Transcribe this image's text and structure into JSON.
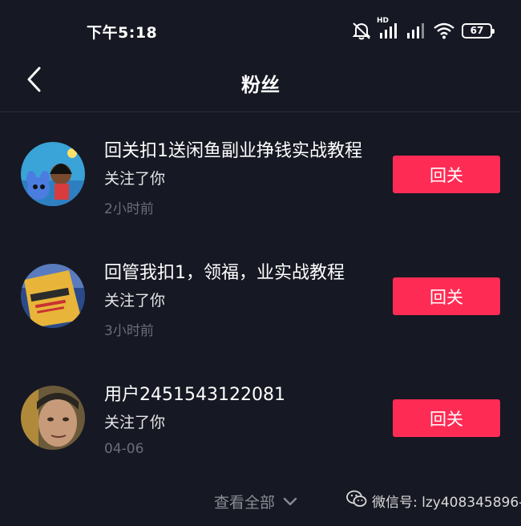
{
  "status_bar": {
    "time": "下午5:18",
    "hd_label": "HD",
    "battery": "67"
  },
  "header": {
    "title": "粉丝"
  },
  "followers": [
    {
      "name": "回关扣1送闲鱼副业挣钱实战教程",
      "action_text": "关注了你",
      "time": "2小时前",
      "button_label": "回关",
      "avatar_icon": "cartoon-avatar-icon"
    },
    {
      "name": "回管我扣1，领福，业实战教程",
      "action_text": "关注了你",
      "time": "3小时前",
      "button_label": "回关",
      "avatar_icon": "book-avatar-icon"
    },
    {
      "name": "用户2451543122081",
      "action_text": "关注了你",
      "time": "04-06",
      "button_label": "回关",
      "avatar_icon": "person-avatar-icon"
    }
  ],
  "footer": {
    "view_all": "查看全部",
    "watermark": "微信号: lzy408345896-"
  },
  "colors": {
    "background": "#161823",
    "accent": "#fe2c55",
    "secondary_text": "#6b6d78"
  }
}
